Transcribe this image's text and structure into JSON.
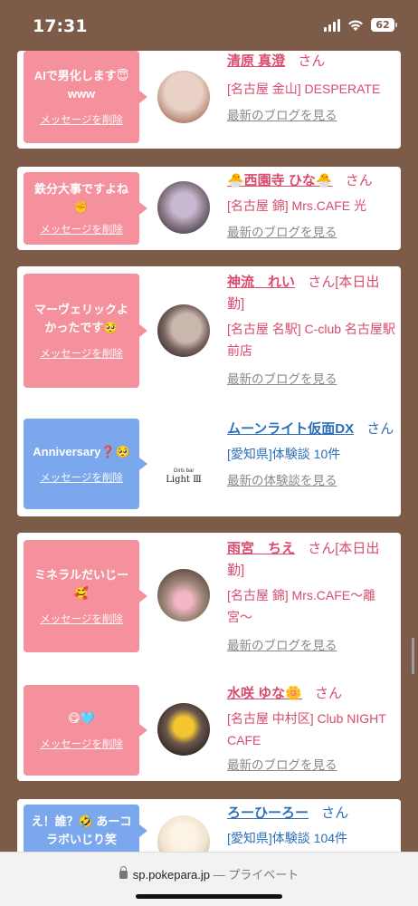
{
  "status_bar": {
    "time": "17:31",
    "battery": "62"
  },
  "url_bar": {
    "host": "sp.pokepara.jp",
    "separator": " — ",
    "mode": "プライベート"
  },
  "delete_label": "メッセージを削除",
  "cards": [
    {
      "color": "pink",
      "message": "AIで男化します😇 www",
      "name": "清原 真澄",
      "honorific": "さん",
      "name_suffix": "",
      "detail": "[名古屋 金山] DESPERATE",
      "link": "最新のブログを見る",
      "avatar_colors": [
        "#e9d1c5",
        "#b58573"
      ]
    },
    {
      "color": "pink",
      "message": "鉄分大事ですよね✊",
      "name": "🐣西園寺 ひな🐣",
      "honorific": "さん",
      "name_suffix": "",
      "detail": "[名古屋 錦] Mrs.CAFE 光",
      "link": "最新のブログを見る",
      "avatar_colors": [
        "#8a7986",
        "#4e4452"
      ]
    },
    {
      "color": "pink",
      "message": "マーヴェリックよかったです🥺",
      "name": "神流　れい",
      "honorific": "さん",
      "name_suffix": "[本日出勤]",
      "detail": "[名古屋 名駅] C-club 名古屋駅前店",
      "link": "最新のブログを見る",
      "avatar_colors": [
        "#c9b6ac",
        "#3d3432"
      ]
    },
    {
      "color": "blue",
      "message": "Anniversary❓🥺",
      "name": "ムーンライト仮面DX",
      "honorific": "さん",
      "name_suffix": "",
      "detail": "[愛知県]体験談 10件",
      "link": "最新の体験談を見る",
      "avatar_colors": [
        "#ffffff",
        "#ffffff"
      ],
      "logo_small": "Girls bar",
      "logo_text": "Light Ⅲ"
    },
    {
      "color": "pink",
      "message": "ミネラルだいじー🥰",
      "name": "雨宮　ちえ",
      "honorific": "さん",
      "name_suffix": "[本日出勤]",
      "detail": "[名古屋 錦] Mrs.CAFE〜離宮〜",
      "link": "最新のブログを見る",
      "avatar_colors": [
        "#a28a7c",
        "#5f4d45"
      ]
    },
    {
      "color": "pink",
      "message": "😋🩵",
      "name": "水咲 ゆな🌼",
      "honorific": "さん",
      "name_suffix": "",
      "detail": "[名古屋 中村区] Club NIGHT CAFE",
      "link": "最新のブログを見る",
      "avatar_colors": [
        "#6b574e",
        "#2c2320"
      ]
    },
    {
      "color": "blue",
      "message": "え！誰？🤣 あーコラボいじり笑",
      "name": "ろーひーろー",
      "honorific": "さん",
      "name_suffix": "",
      "detail": "[愛知県]体験談 104件",
      "link": "",
      "avatar_colors": [
        "#f2e4cf",
        "#c7b08f"
      ]
    }
  ]
}
